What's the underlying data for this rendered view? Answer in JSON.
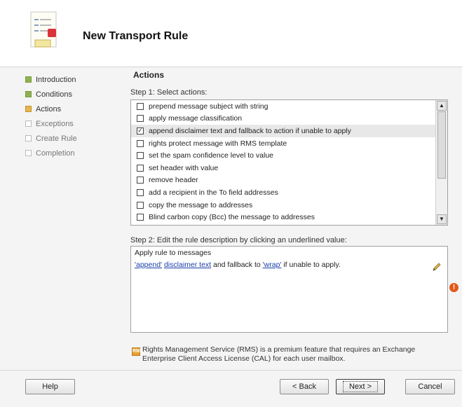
{
  "wizard": {
    "title": "New Transport Rule",
    "steps": [
      {
        "label": "Introduction",
        "state": "done"
      },
      {
        "label": "Conditions",
        "state": "done"
      },
      {
        "label": "Actions",
        "state": "current"
      },
      {
        "label": "Exceptions",
        "state": "pending"
      },
      {
        "label": "Create Rule",
        "state": "pending"
      },
      {
        "label": "Completion",
        "state": "pending"
      }
    ]
  },
  "main": {
    "section_title": "Actions",
    "step1_label": "Step 1: Select actions:",
    "actions": [
      {
        "label": "prepend message subject with string",
        "checked": false
      },
      {
        "label": "apply message classification",
        "checked": false
      },
      {
        "label": "append disclaimer text and fallback to action if unable to apply",
        "checked": true
      },
      {
        "label": "rights protect message with RMS template",
        "checked": false
      },
      {
        "label": "set the spam confidence level to value",
        "checked": false
      },
      {
        "label": "set header with value",
        "checked": false
      },
      {
        "label": "remove header",
        "checked": false
      },
      {
        "label": "add a recipient in the To field addresses",
        "checked": false
      },
      {
        "label": "copy the message to addresses",
        "checked": false
      },
      {
        "label": "Blind carbon copy (Bcc) the message to addresses",
        "checked": false
      }
    ],
    "step2_label": "Step 2: Edit the rule description by clicking an underlined value:",
    "description": {
      "line1": "Apply rule to messages",
      "link_append": "'append'",
      "link_disclaimer": "disclaimer text",
      "text_fallback": "and fallback to",
      "link_wrap": "'wrap'",
      "text_end": "if unable to apply."
    },
    "info_text": "Rights Management Service (RMS) is a premium feature that requires an Exchange Enterprise Client Access License (CAL) for each user mailbox."
  },
  "footer": {
    "help_label": "Help",
    "back_label": "< Back",
    "next_label": "Next >",
    "cancel_label": "Cancel"
  },
  "colors": {
    "step_done": "#8fb250",
    "step_current": "#e8b54a",
    "link": "#1a3fa8",
    "warning": "#e05a1b"
  },
  "icons": [
    "wizard-header-icon",
    "checkbox-icon",
    "scroll-up-icon",
    "scroll-down-icon",
    "pencil-icon",
    "warning-icon",
    "info-icon"
  ]
}
